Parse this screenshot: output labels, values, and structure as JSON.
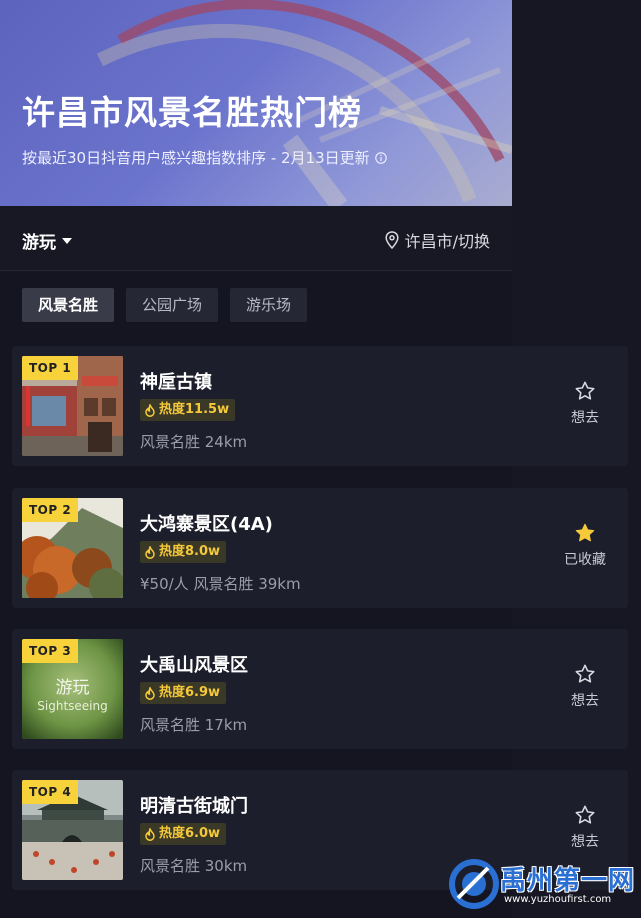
{
  "hero": {
    "title": "许昌市风景名胜热门榜",
    "subtitle": "按最近30日抖音用户感兴趣指数排序 - 2月13日更新"
  },
  "filter": {
    "category": "游玩",
    "city": "许昌市/切换"
  },
  "tabs": [
    "风景名胜",
    "公园广场",
    "游乐场"
  ],
  "items": [
    {
      "rank": "TOP 1",
      "name": "神垕古镇",
      "heat": "热度11.5w",
      "meta": "风景名胜  24km",
      "fav_label": "想去",
      "saved": false
    },
    {
      "rank": "TOP 2",
      "name": "大鸿寨景区(4A)",
      "heat": "热度8.0w",
      "meta": "¥50/人  风景名胜  39km",
      "fav_label": "已收藏",
      "saved": true
    },
    {
      "rank": "TOP 3",
      "name": "大禹山风景区",
      "heat": "热度6.9w",
      "meta": "风景名胜  17km",
      "fav_label": "想去",
      "saved": false,
      "thumb_title": "游玩",
      "thumb_subtitle": "Sightseeing"
    },
    {
      "rank": "TOP 4",
      "name": "明清古街城门",
      "heat": "热度6.0w",
      "meta": "风景名胜  30km",
      "fav_label": "想去",
      "saved": false
    }
  ],
  "watermark": {
    "title": "禹州第一网",
    "url": "www.yuzhoufirst.com"
  },
  "colors": {
    "background": "#141520",
    "card": "#1d1e2b",
    "badge": "#f7d23a",
    "heat": "#f5c93a",
    "saved_star": "#f5c93a"
  }
}
